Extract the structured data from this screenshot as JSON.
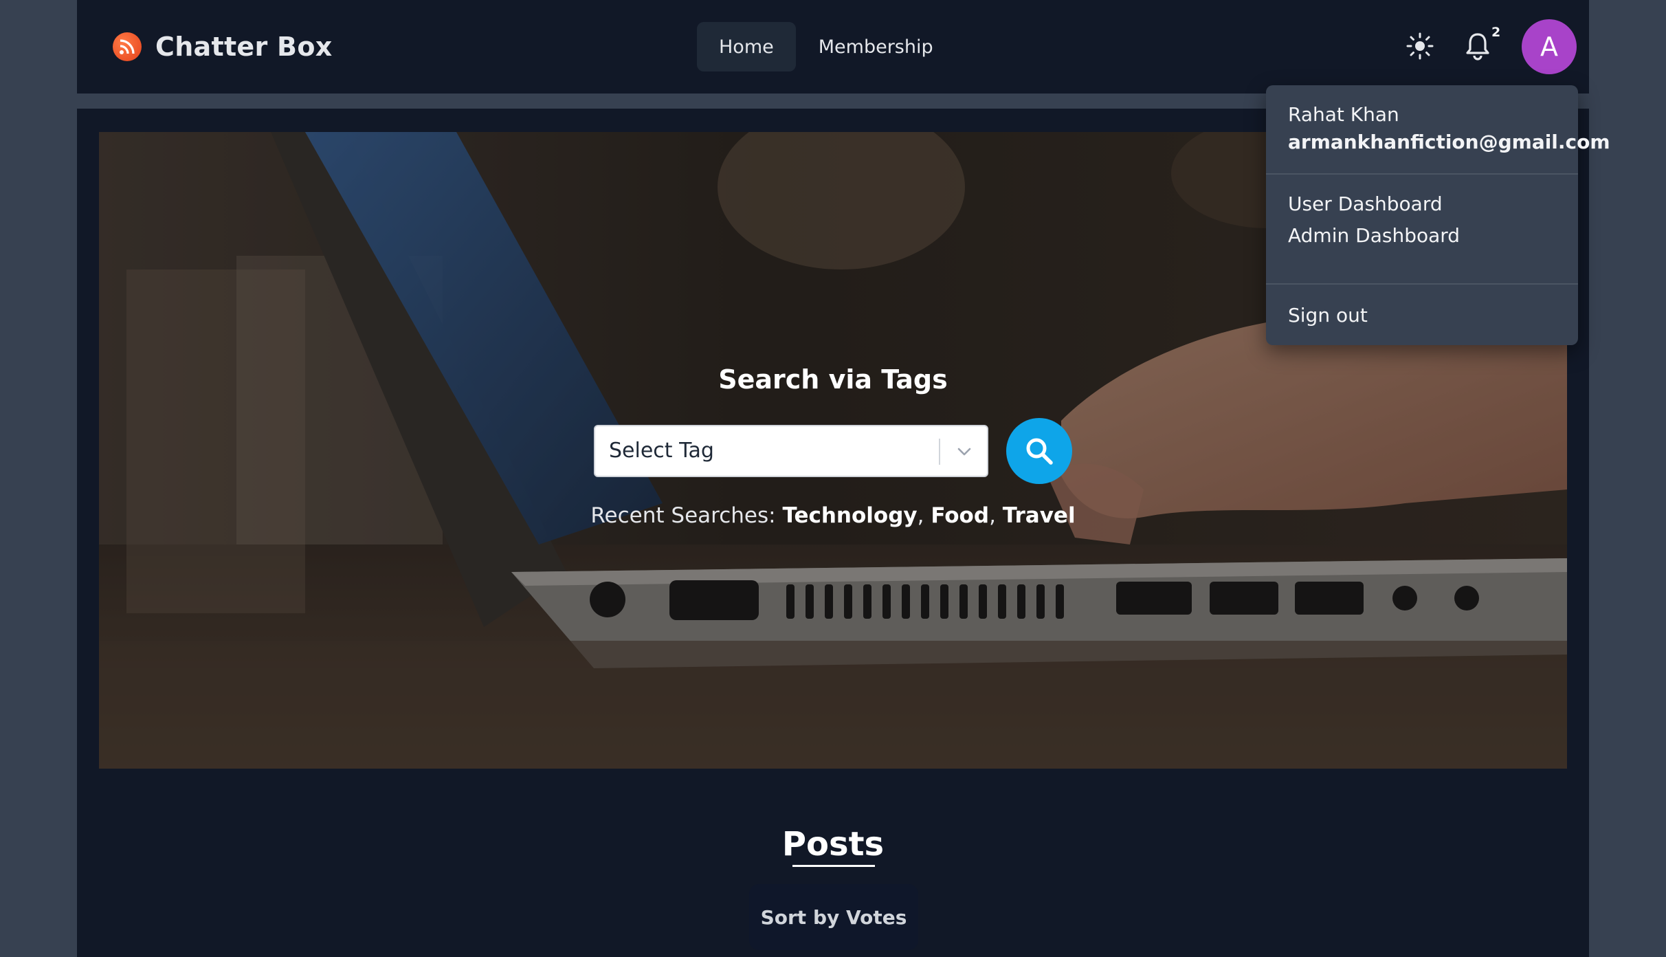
{
  "brand": {
    "name": "Chatter Box",
    "icon": "rss-feed-icon",
    "accent": "#e4411b"
  },
  "nav": {
    "links": [
      {
        "label": "Home",
        "active": true
      },
      {
        "label": "Membership",
        "active": false
      }
    ]
  },
  "header": {
    "theme_icon": "sun-icon",
    "notification_icon": "bell-icon",
    "notification_count": "2",
    "avatar_initial": "A",
    "avatar_color": "#a843c9"
  },
  "user_menu": {
    "name": "Rahat Khan",
    "email": "armankhanfiction@gmail.com",
    "items": [
      "User Dashboard",
      "Admin Dashboard"
    ],
    "sign_out": "Sign out"
  },
  "hero": {
    "title": "Search via Tags",
    "select_placeholder": "Select Tag",
    "search_button_icon": "search-icon",
    "search_button_color": "#0ea5e9",
    "recent_label": "Recent Searches:",
    "recent_tags": [
      "Technology",
      "Food",
      "Travel"
    ]
  },
  "posts": {
    "title": "Posts",
    "sort_label": "Sort by Votes"
  }
}
